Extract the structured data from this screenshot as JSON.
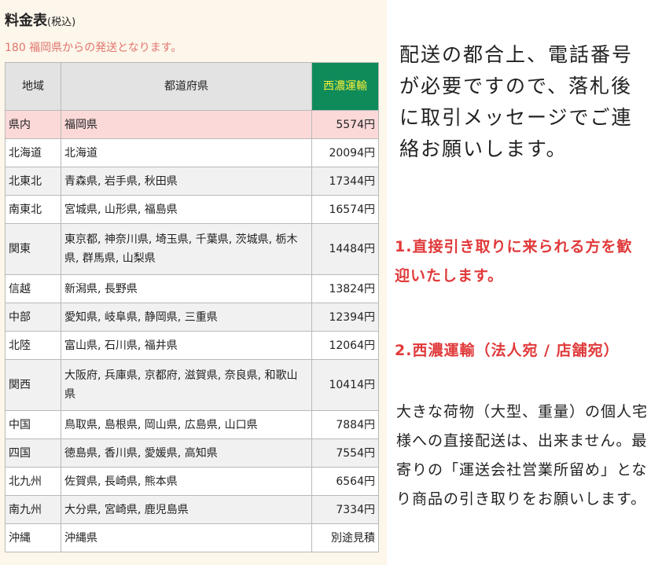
{
  "title": {
    "main": "料金表",
    "note": "(税込)"
  },
  "notice": "180 福岡県からの発送となります。",
  "table": {
    "headers": {
      "region": "地域",
      "prefectures": "都道府県",
      "carrier": "西濃運輸"
    },
    "rows": [
      {
        "region": "県内",
        "prefectures": "福岡県",
        "price": "5574円"
      },
      {
        "region": "北海道",
        "prefectures": "北海道",
        "price": "20094円"
      },
      {
        "region": "北東北",
        "prefectures": "青森県, 岩手県, 秋田県",
        "price": "17344円"
      },
      {
        "region": "南東北",
        "prefectures": "宮城県, 山形県, 福島県",
        "price": "16574円"
      },
      {
        "region": "関東",
        "prefectures": "東京都, 神奈川県, 埼玉県, 千葉県, 茨城県, 栃木県, 群馬県, 山梨県",
        "price": "14484円"
      },
      {
        "region": "信越",
        "prefectures": "新潟県, 長野県",
        "price": "13824円"
      },
      {
        "region": "中部",
        "prefectures": "愛知県, 岐阜県, 静岡県, 三重県",
        "price": "12394円"
      },
      {
        "region": "北陸",
        "prefectures": "富山県, 石川県, 福井県",
        "price": "12064円"
      },
      {
        "region": "関西",
        "prefectures": "大阪府, 兵庫県, 京都府, 滋賀県, 奈良県, 和歌山県",
        "price": "10414円"
      },
      {
        "region": "中国",
        "prefectures": "鳥取県, 島根県, 岡山県, 広島県, 山口県",
        "price": "7884円"
      },
      {
        "region": "四国",
        "prefectures": "徳島県, 香川県, 愛媛県, 高知県",
        "price": "7554円"
      },
      {
        "region": "北九州",
        "prefectures": "佐賀県, 長崎県, 熊本県",
        "price": "6564円"
      },
      {
        "region": "南九州",
        "prefectures": "大分県, 宮崎県, 鹿児島県",
        "price": "7334円"
      },
      {
        "region": "沖縄",
        "prefectures": "沖縄県",
        "price": "別途見積"
      }
    ]
  },
  "info": {
    "main": "配送の都合上、電話番号が必要ですので、落札後に取引メッセージでご連絡お願いします。",
    "pickup": "1.直接引き取りに来られる方を歓迎いたします。",
    "seino_heading": "2.西濃運輸（法人宛 / 店舗宛）",
    "seino_body": "大きな荷物（大型、重量）の個人宅様への直接配送は、出来ません。最寄りの「運送会社営業所留め」となり商品の引き取りをお願いします。"
  },
  "colors": {
    "panel_bg": "#fdf6ea",
    "header_gray": "#e3e3e3",
    "carrier_bg": "#0f8b5a",
    "carrier_text": "#f4ee3a",
    "highlight_row": "#fcd9d9",
    "notice_text": "#e0766f",
    "accent_red": "#e0393a"
  }
}
